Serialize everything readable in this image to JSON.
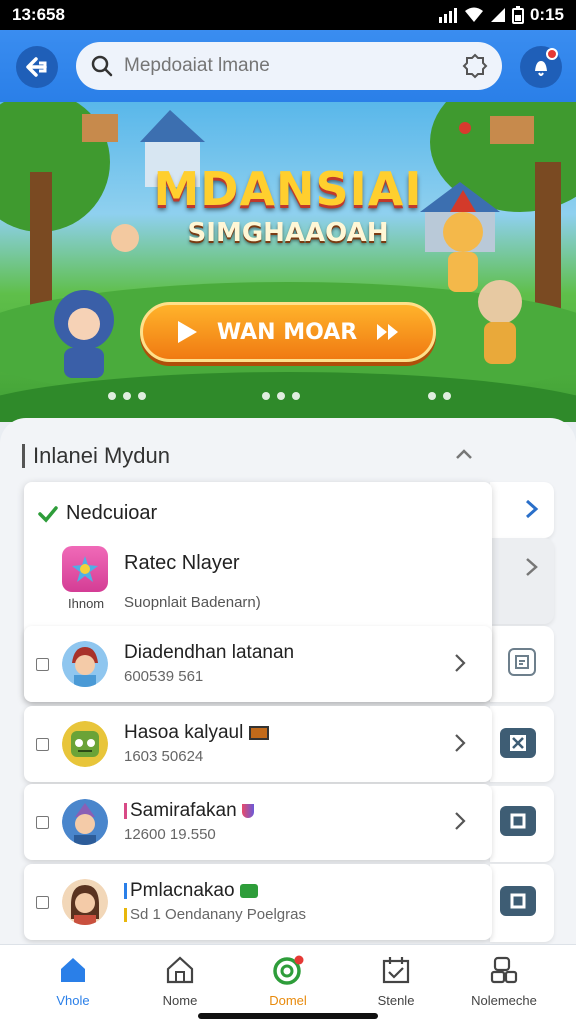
{
  "status": {
    "time": "13:658",
    "right_time": "0:15"
  },
  "search": {
    "placeholder": "Mepdoaiat lmane"
  },
  "banner": {
    "title": "MDANSIAI",
    "subtitle": "SIMGHAAOAH",
    "play_label": "WAN MOAR",
    "dot_groups": 3
  },
  "section": {
    "title": "Inlanei Mydun"
  },
  "popup": {
    "header": "Nedcuioar",
    "rated_title": "Ratec Nlayer",
    "rated_caption": "Ihnom",
    "rated_sub": "Suopnlait  Badenarn)"
  },
  "rows": [
    {
      "title": "Diadendhan latanan",
      "sub": "600539 561"
    },
    {
      "title": "Hasoa kalyaul",
      "sub": "1603 50624"
    },
    {
      "title": "Samirafakan",
      "sub": "12600 19.550"
    },
    {
      "title": "Pmlacnakao",
      "sub": "Sd 1 Oendanany Poelgras"
    }
  ],
  "nav": [
    {
      "label": "Vhole"
    },
    {
      "label": "Nome"
    },
    {
      "label": "Domel"
    },
    {
      "label": "Stenle"
    },
    {
      "label": "Nolemeche"
    }
  ],
  "colors": {
    "accent": "#2a7fe8",
    "play": "#f07a12",
    "check": "#2e9d3a"
  }
}
